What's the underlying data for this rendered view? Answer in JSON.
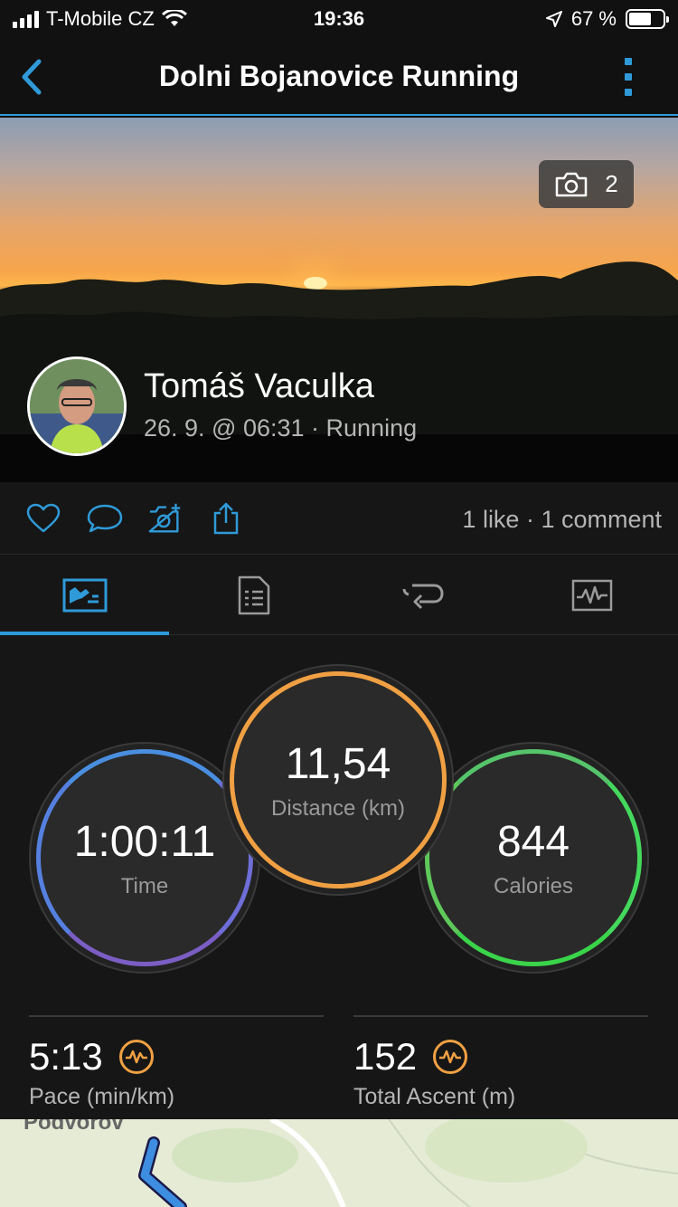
{
  "status_bar": {
    "carrier": "T-Mobile CZ",
    "time": "19:36",
    "battery_text": "67 %",
    "battery_level": 0.67
  },
  "nav": {
    "title": "Dolni Bojanovice Running",
    "back_icon": "chevron-left-icon",
    "menu_icon": "more-vertical-icon"
  },
  "hero": {
    "photo_count": "2",
    "user_name": "Tomáš Vaculka",
    "meta": "26. 9. @ 06:31 · Running"
  },
  "social": {
    "stats": "1 like · 1 comment",
    "icons": [
      "heart-icon",
      "comment-icon",
      "add-photo-icon",
      "share-icon"
    ]
  },
  "tabs": [
    {
      "name": "overview",
      "icon": "overview-chart-icon",
      "active": true
    },
    {
      "name": "details",
      "icon": "document-list-icon",
      "active": false
    },
    {
      "name": "laps",
      "icon": "laps-loop-icon",
      "active": false
    },
    {
      "name": "charts",
      "icon": "activity-chart-icon",
      "active": false
    }
  ],
  "stats": {
    "time": {
      "value": "1:00:11",
      "label": "Time"
    },
    "distance": {
      "value": "11,54",
      "label": "Distance (km)"
    },
    "calories": {
      "value": "844",
      "label": "Calories"
    },
    "pace": {
      "value": "5:13",
      "label": "Pace (min/km)"
    },
    "ascent": {
      "value": "152",
      "label": "Total Ascent (m)"
    }
  },
  "colors": {
    "accent": "#2f9ad8",
    "distance_ring": "#f0a043",
    "calories_ring": "#44d85c",
    "time_ring": "#6e6ed8"
  },
  "map": {
    "place_label": "Podvorov"
  }
}
